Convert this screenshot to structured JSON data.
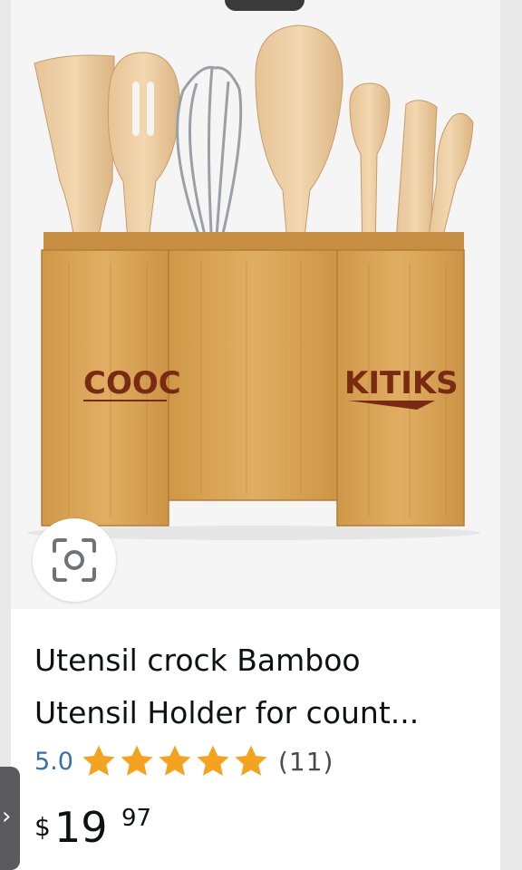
{
  "product": {
    "image_alt": "Bamboo utensil crock with wooden spatulas, whisk and spoons",
    "brand_marks": [
      "COOC",
      "KITIKS"
    ],
    "title_line1": "Utensil crock Bamboo",
    "title_line2": "Utensil Holder for count...",
    "rating_value": "5.0",
    "rating_stars": 5,
    "review_count": "(11)",
    "price_currency": "$",
    "price_whole": "19",
    "price_fraction": "97"
  },
  "colors": {
    "star": "#f3a320",
    "rating_link": "#3a6ea8",
    "bamboo": "#d9a45a",
    "text": "#0f1111"
  },
  "icons": {
    "visual_search": "camera-lens-icon",
    "back": "chevron-right-icon",
    "star": "star-icon"
  }
}
